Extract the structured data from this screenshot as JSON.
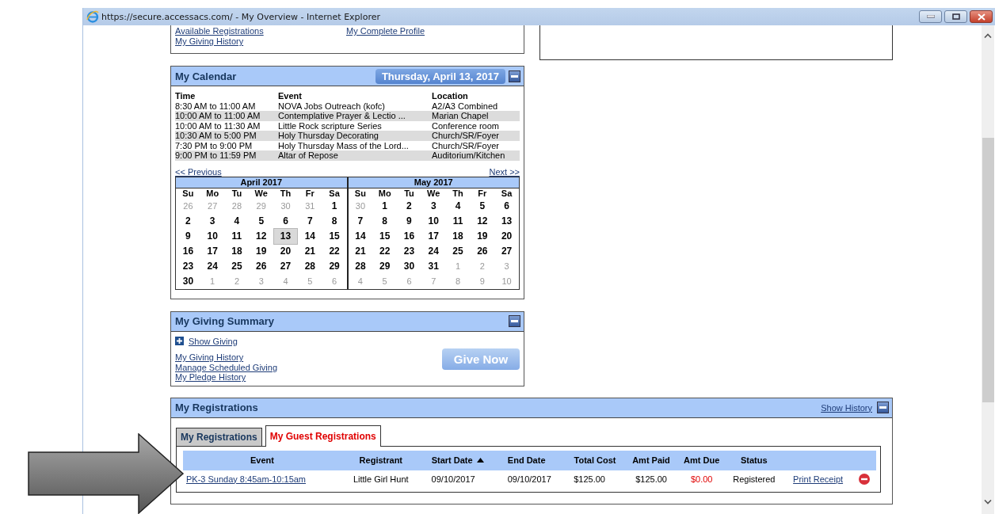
{
  "window": {
    "title": "https://secure.accessacs.com/ - My Overview - Internet Explorer"
  },
  "top_links": {
    "left": [
      "Available Registrations",
      "My Giving History"
    ],
    "right": [
      "My Complete Profile"
    ]
  },
  "calendar": {
    "title": "My Calendar",
    "date": "Thursday, April 13, 2017",
    "columns": [
      "Time",
      "Event",
      "Location"
    ],
    "events": [
      {
        "time": "8:30 AM to 11:00 AM",
        "event": "NOVA Jobs Outreach (kofc)",
        "location": "A2/A3 Combined"
      },
      {
        "time": "10:00 AM to 11:00 AM",
        "event": "Contemplative Prayer & Lectio ...",
        "location": "Marian Chapel"
      },
      {
        "time": "10:00 AM to 11:30 AM",
        "event": "Little Rock scripture Series",
        "location": "Conference room"
      },
      {
        "time": "10:30 AM to 5:00 PM",
        "event": "Holy Thursday Decorating",
        "location": "Church/SR/Foyer"
      },
      {
        "time": "7:30 PM to 9:00 PM",
        "event": "Holy Thursday Mass of the Lord...",
        "location": "Church/SR/Foyer"
      },
      {
        "time": "9:00 PM to 11:59 PM",
        "event": "Altar of Repose",
        "location": "Auditorium/Kitchen"
      }
    ],
    "previous": "<< Previous",
    "next": "Next >>",
    "months": [
      {
        "title": "April 2017",
        "weekdays": [
          "Su",
          "Mo",
          "Tu",
          "We",
          "Th",
          "Fr",
          "Sa"
        ],
        "days": [
          {
            "label": "26",
            "muted": true,
            "selected": false
          },
          {
            "label": "27",
            "muted": true,
            "selected": false
          },
          {
            "label": "28",
            "muted": true,
            "selected": false
          },
          {
            "label": "29",
            "muted": true,
            "selected": false
          },
          {
            "label": "30",
            "muted": true,
            "selected": false
          },
          {
            "label": "31",
            "muted": true,
            "selected": false
          },
          {
            "label": "1",
            "muted": false,
            "selected": false
          },
          {
            "label": "2",
            "muted": false,
            "selected": false
          },
          {
            "label": "3",
            "muted": false,
            "selected": false
          },
          {
            "label": "4",
            "muted": false,
            "selected": false
          },
          {
            "label": "5",
            "muted": false,
            "selected": false
          },
          {
            "label": "6",
            "muted": false,
            "selected": false
          },
          {
            "label": "7",
            "muted": false,
            "selected": false
          },
          {
            "label": "8",
            "muted": false,
            "selected": false
          },
          {
            "label": "9",
            "muted": false,
            "selected": false
          },
          {
            "label": "10",
            "muted": false,
            "selected": false
          },
          {
            "label": "11",
            "muted": false,
            "selected": false
          },
          {
            "label": "12",
            "muted": false,
            "selected": false
          },
          {
            "label": "13",
            "muted": false,
            "selected": true
          },
          {
            "label": "14",
            "muted": false,
            "selected": false
          },
          {
            "label": "15",
            "muted": false,
            "selected": false
          },
          {
            "label": "16",
            "muted": false,
            "selected": false
          },
          {
            "label": "17",
            "muted": false,
            "selected": false
          },
          {
            "label": "18",
            "muted": false,
            "selected": false
          },
          {
            "label": "19",
            "muted": false,
            "selected": false
          },
          {
            "label": "20",
            "muted": false,
            "selected": false
          },
          {
            "label": "21",
            "muted": false,
            "selected": false
          },
          {
            "label": "22",
            "muted": false,
            "selected": false
          },
          {
            "label": "23",
            "muted": false,
            "selected": false
          },
          {
            "label": "24",
            "muted": false,
            "selected": false
          },
          {
            "label": "25",
            "muted": false,
            "selected": false
          },
          {
            "label": "26",
            "muted": false,
            "selected": false
          },
          {
            "label": "27",
            "muted": false,
            "selected": false
          },
          {
            "label": "28",
            "muted": false,
            "selected": false
          },
          {
            "label": "29",
            "muted": false,
            "selected": false
          },
          {
            "label": "30",
            "muted": false,
            "selected": false
          },
          {
            "label": "1",
            "muted": true,
            "selected": false
          },
          {
            "label": "2",
            "muted": true,
            "selected": false
          },
          {
            "label": "3",
            "muted": true,
            "selected": false
          },
          {
            "label": "4",
            "muted": true,
            "selected": false
          },
          {
            "label": "5",
            "muted": true,
            "selected": false
          },
          {
            "label": "6",
            "muted": true,
            "selected": false
          }
        ]
      },
      {
        "title": "May 2017",
        "weekdays": [
          "Su",
          "Mo",
          "Tu",
          "We",
          "Th",
          "Fr",
          "Sa"
        ],
        "days": [
          {
            "label": "30",
            "muted": true,
            "selected": false
          },
          {
            "label": "1",
            "muted": false,
            "selected": false
          },
          {
            "label": "2",
            "muted": false,
            "selected": false
          },
          {
            "label": "3",
            "muted": false,
            "selected": false
          },
          {
            "label": "4",
            "muted": false,
            "selected": false
          },
          {
            "label": "5",
            "muted": false,
            "selected": false
          },
          {
            "label": "6",
            "muted": false,
            "selected": false
          },
          {
            "label": "7",
            "muted": false,
            "selected": false
          },
          {
            "label": "8",
            "muted": false,
            "selected": false
          },
          {
            "label": "9",
            "muted": false,
            "selected": false
          },
          {
            "label": "10",
            "muted": false,
            "selected": false
          },
          {
            "label": "11",
            "muted": false,
            "selected": false
          },
          {
            "label": "12",
            "muted": false,
            "selected": false
          },
          {
            "label": "13",
            "muted": false,
            "selected": false
          },
          {
            "label": "14",
            "muted": false,
            "selected": false
          },
          {
            "label": "15",
            "muted": false,
            "selected": false
          },
          {
            "label": "16",
            "muted": false,
            "selected": false
          },
          {
            "label": "17",
            "muted": false,
            "selected": false
          },
          {
            "label": "18",
            "muted": false,
            "selected": false
          },
          {
            "label": "19",
            "muted": false,
            "selected": false
          },
          {
            "label": "20",
            "muted": false,
            "selected": false
          },
          {
            "label": "21",
            "muted": false,
            "selected": false
          },
          {
            "label": "22",
            "muted": false,
            "selected": false
          },
          {
            "label": "23",
            "muted": false,
            "selected": false
          },
          {
            "label": "24",
            "muted": false,
            "selected": false
          },
          {
            "label": "25",
            "muted": false,
            "selected": false
          },
          {
            "label": "26",
            "muted": false,
            "selected": false
          },
          {
            "label": "27",
            "muted": false,
            "selected": false
          },
          {
            "label": "28",
            "muted": false,
            "selected": false
          },
          {
            "label": "29",
            "muted": false,
            "selected": false
          },
          {
            "label": "30",
            "muted": false,
            "selected": false
          },
          {
            "label": "31",
            "muted": false,
            "selected": false
          },
          {
            "label": "1",
            "muted": true,
            "selected": false
          },
          {
            "label": "2",
            "muted": true,
            "selected": false
          },
          {
            "label": "3",
            "muted": true,
            "selected": false
          },
          {
            "label": "4",
            "muted": true,
            "selected": false
          },
          {
            "label": "5",
            "muted": true,
            "selected": false
          },
          {
            "label": "6",
            "muted": true,
            "selected": false
          },
          {
            "label": "7",
            "muted": true,
            "selected": false
          },
          {
            "label": "8",
            "muted": true,
            "selected": false
          },
          {
            "label": "9",
            "muted": true,
            "selected": false
          },
          {
            "label": "10",
            "muted": true,
            "selected": false
          }
        ]
      }
    ]
  },
  "giving": {
    "title": "My Giving Summary",
    "show_giving": "Show Giving",
    "links": [
      "My Giving History",
      "Manage Scheduled Giving",
      "My Pledge History"
    ],
    "give_button": "Give Now"
  },
  "registrations": {
    "title": "My Registrations",
    "show_history": "Show History",
    "tabs": [
      {
        "label": "My Registrations",
        "selected": false
      },
      {
        "label": "My Guest Registrations",
        "selected": true
      }
    ],
    "columns": [
      {
        "label": "Event",
        "sorted": false
      },
      {
        "label": "Registrant",
        "sorted": false
      },
      {
        "label": "Start Date",
        "sorted": true
      },
      {
        "label": "End Date",
        "sorted": false
      },
      {
        "label": "Total Cost",
        "sorted": false
      },
      {
        "label": "Amt Paid",
        "sorted": false
      },
      {
        "label": "Amt Due",
        "sorted": false
      },
      {
        "label": "Status",
        "sorted": false
      }
    ],
    "rows": [
      {
        "event": "PK-3 Sunday 8:45am-10:15am",
        "registrant": "Little Girl Hunt",
        "start_date": "09/10/2017",
        "end_date": "09/10/2017",
        "total_cost": "$125.00",
        "amt_paid": "$125.00",
        "amt_due": "$0.00",
        "status": "Registered",
        "action": "Print Receipt"
      }
    ]
  }
}
